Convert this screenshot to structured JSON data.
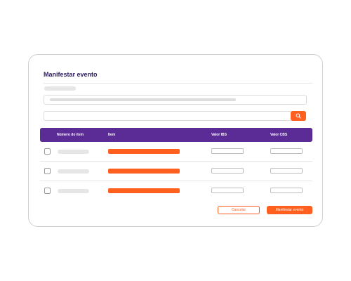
{
  "dialog": {
    "title": "Manifestar evento"
  },
  "search": {
    "value": "",
    "placeholder": "",
    "icon": "search-icon"
  },
  "table": {
    "columns": [
      "Número do item",
      "Item",
      "Valor IBS",
      "Valor CBS"
    ],
    "rows": [
      {
        "checked": false,
        "valor_ibs": "",
        "valor_cbs": ""
      },
      {
        "checked": false,
        "valor_ibs": "",
        "valor_cbs": ""
      },
      {
        "checked": false,
        "valor_ibs": "",
        "valor_cbs": ""
      }
    ]
  },
  "actions": {
    "cancel_label": "Cancelar",
    "primary_label": "Manifestar evento"
  },
  "colors": {
    "brand_purple": "#5b2b96",
    "accent_orange": "#ff5f1f",
    "title_text": "#2b1b5c"
  }
}
